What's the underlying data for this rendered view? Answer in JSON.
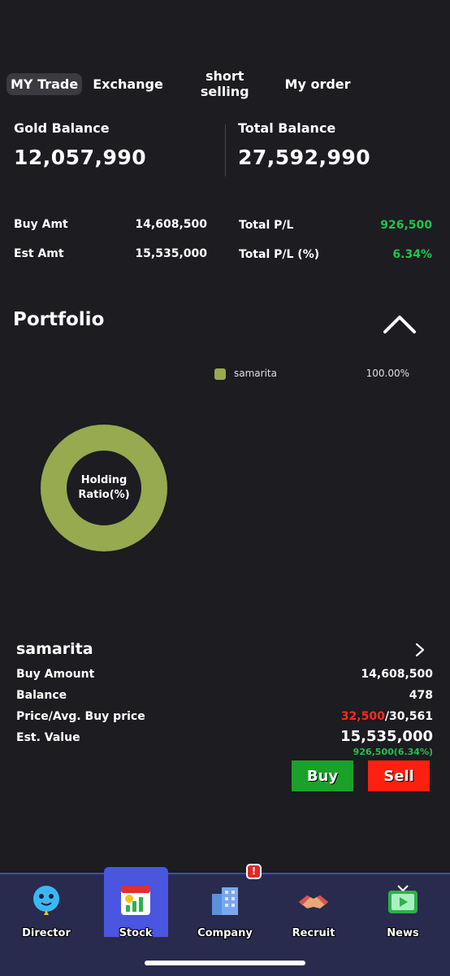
{
  "tabs": [
    {
      "label": "MY Trade"
    },
    {
      "label": "Exchange"
    },
    {
      "label": "short\nselling"
    },
    {
      "label": "My order"
    }
  ],
  "balances": {
    "gold_label": "Gold Balance",
    "gold_value": "12,057,990",
    "total_label": "Total Balance",
    "total_value": "27,592,990"
  },
  "stats": {
    "buy_amt_label": "Buy Amt",
    "buy_amt_value": "14,608,500",
    "est_amt_label": "Est Amt",
    "est_amt_value": "15,535,000",
    "total_pl_label": "Total P/L",
    "total_pl_value": "926,500",
    "total_pl_pct_label": "Total P/L (%)",
    "total_pl_pct_value": "6.34%"
  },
  "portfolio": {
    "title": "Portfolio",
    "legend": [
      {
        "name": "samarita",
        "percent": "100.00%",
        "color": "#97aa4f"
      }
    ],
    "donut_label": "Holding\nRatio(%)"
  },
  "holding": {
    "name": "samarita",
    "buy_amount_label": "Buy Amount",
    "buy_amount_value": "14,608,500",
    "balance_label": "Balance",
    "balance_value": "478",
    "price_label": "Price/Avg. Buy price",
    "price_current": "32,500",
    "price_separator": "/",
    "price_avg": "30,561",
    "est_value_label": "Est. Value",
    "est_value_value": "15,535,000",
    "est_value_change": "926,500(6.34%)"
  },
  "actions": {
    "buy_label": "Buy",
    "sell_label": "Sell"
  },
  "nav": {
    "items": [
      {
        "label": "Director",
        "icon": "director-icon"
      },
      {
        "label": "Stock",
        "icon": "stock-icon"
      },
      {
        "label": "Company",
        "icon": "company-icon"
      },
      {
        "label": "Recruit",
        "icon": "recruit-icon"
      },
      {
        "label": "News",
        "icon": "news-icon"
      }
    ],
    "active_index": 1,
    "alert_badge": "!"
  },
  "colors": {
    "background": "#1c1c21",
    "positive": "#1fc44a",
    "negative": "#ff2a1a",
    "buy_button": "#1aa12a",
    "sell_button": "#ff1f0f",
    "nav_active": "#4a55e0"
  }
}
